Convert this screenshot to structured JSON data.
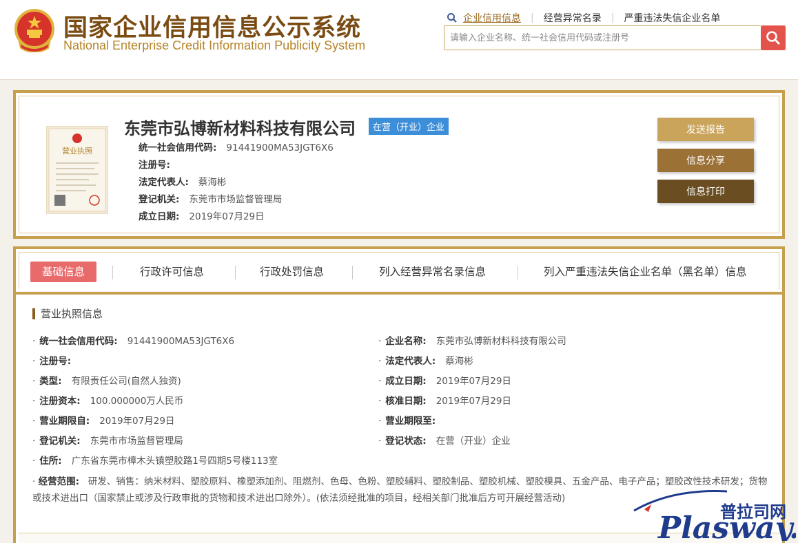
{
  "header": {
    "title_cn": "国家企业信用信息公示系统",
    "title_en": "National Enterprise Credit Information Publicity System",
    "nav": [
      "企业信用信息",
      "经营异常名录",
      "严重违法失信企业名单"
    ],
    "search_placeholder": "请输入企业名称、统一社会信用代码或注册号"
  },
  "company": {
    "name": "东莞市弘博新材料科技有限公司",
    "status": "在营（开业）企业",
    "summary": [
      {
        "label": "统一社会信用代码:",
        "value": "91441900MA53JGT6X6"
      },
      {
        "label": "注册号:",
        "value": ""
      },
      {
        "label": "法定代表人:",
        "value": "蔡海彬"
      },
      {
        "label": "登记机关:",
        "value": "东莞市市场监督管理局"
      },
      {
        "label": "成立日期:",
        "value": "2019年07月29日"
      }
    ],
    "buttons": {
      "report": "发送报告",
      "share": "信息分享",
      "print": "信息打印"
    }
  },
  "tabs": [
    "基础信息",
    "行政许可信息",
    "行政处罚信息",
    "列入经营异常名录信息",
    "列入严重违法失信企业名单（黑名单）信息"
  ],
  "section": {
    "title": "营业执照信息",
    "left": [
      {
        "label": "统一社会信用代码:",
        "value": "91441900MA53JGT6X6"
      },
      {
        "label": "注册号:",
        "value": ""
      },
      {
        "label": "类型:",
        "value": "有限责任公司(自然人独资)"
      },
      {
        "label": "注册资本:",
        "value": "100.000000万人民币"
      },
      {
        "label": "营业期限自:",
        "value": "2019年07月29日"
      },
      {
        "label": "登记机关:",
        "value": "东莞市市场监督管理局"
      },
      {
        "label": "住所:",
        "value": "广东省东莞市樟木头镇塑胶路1号四期5号楼113室"
      }
    ],
    "right": [
      {
        "label": "企业名称:",
        "value": "东莞市弘博新材料科技有限公司"
      },
      {
        "label": "法定代表人:",
        "value": "蔡海彬"
      },
      {
        "label": "成立日期:",
        "value": "2019年07月29日"
      },
      {
        "label": "核准日期:",
        "value": "2019年07月29日"
      },
      {
        "label": "营业期限至:",
        "value": ""
      },
      {
        "label": "登记状态:",
        "value": "在营（开业）企业"
      }
    ],
    "scope_label": "经营范围:",
    "scope_value": "研发、销售：纳米材料、塑胶原料、橡塑添加剂、阻燃剂、色母、色粉、塑胶辅料、塑胶制品、塑胶机械、塑胶模具、五金产品、电子产品；塑胶改性技术研发；货物或技术进出口（国家禁止或涉及行政审批的货物和技术进出口除外）。(依法须经批准的项目，经相关部门批准后方可开展经营活动)"
  },
  "watermark": {
    "cn": "普拉司网",
    "en": "Plasway.com"
  },
  "colors": {
    "gold": "#c7a04d",
    "brown": "#7a4b12",
    "red": "#e4524c",
    "blue": "#3d8ed8"
  }
}
